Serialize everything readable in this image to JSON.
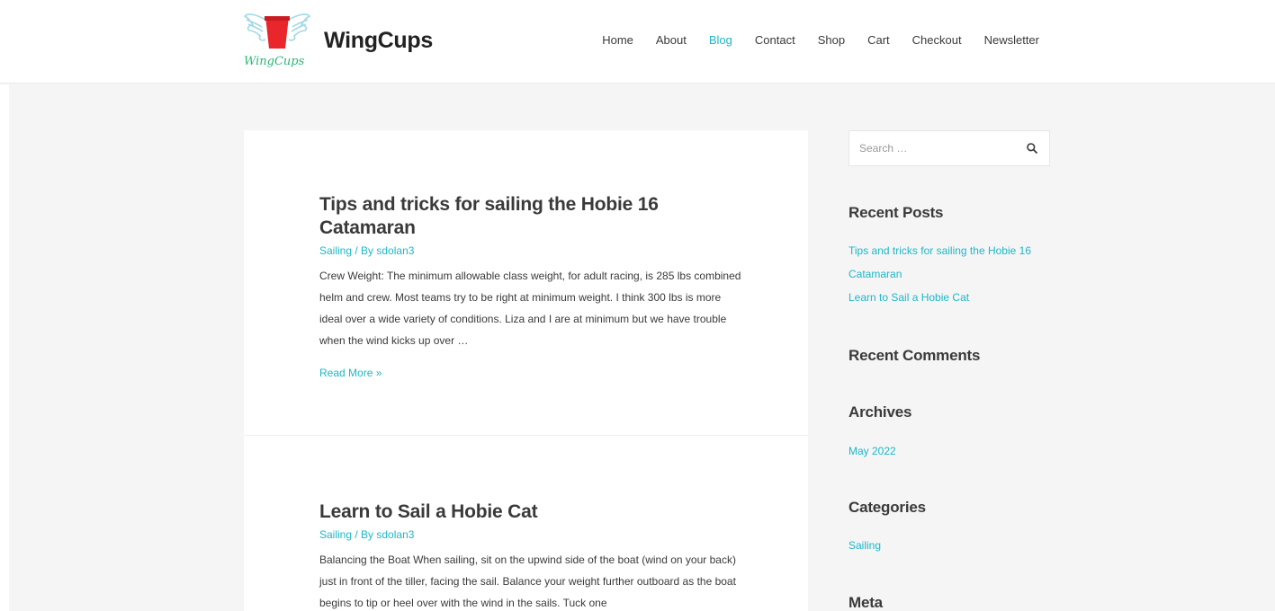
{
  "site": {
    "title": "WingCups",
    "logo_text": "WingCups"
  },
  "nav": {
    "items": [
      {
        "label": "Home"
      },
      {
        "label": "About"
      },
      {
        "label": "Blog"
      },
      {
        "label": "Contact"
      },
      {
        "label": "Shop"
      },
      {
        "label": "Cart"
      },
      {
        "label": "Checkout"
      },
      {
        "label": "Newsletter"
      }
    ],
    "active": "Blog"
  },
  "posts": [
    {
      "title": "Tips and tricks for sailing the Hobie 16 Catamaran",
      "category": "Sailing",
      "separator": " / By ",
      "author": "sdolan3",
      "excerpt": "Crew Weight: The minimum allowable class weight, for adult racing, is 285 lbs combined helm and crew. Most teams try to be right at minimum weight. I think 300 lbs is more ideal over a wide variety of conditions. Liza and I are at minimum but we have trouble when the wind kicks up over …",
      "read_more": "Read More »"
    },
    {
      "title": "Learn to Sail a Hobie Cat",
      "category": "Sailing",
      "separator": " / By ",
      "author": "sdolan3",
      "excerpt": "Balancing the Boat When sailing, sit on the upwind side of the boat (wind on your back) just in front of the tiller, facing the sail. Balance your weight further outboard as the boat begins to tip or heel over with the wind in the sails. Tuck one"
    }
  ],
  "sidebar": {
    "search": {
      "placeholder": "Search …"
    },
    "recent_posts": {
      "title": "Recent Posts",
      "items": [
        "Tips and tricks for sailing the Hobie 16 Catamaran",
        "Learn to Sail a Hobie Cat"
      ]
    },
    "recent_comments": {
      "title": "Recent Comments"
    },
    "archives": {
      "title": "Archives",
      "items": [
        "May 2022"
      ]
    },
    "categories": {
      "title": "Categories",
      "items": [
        "Sailing"
      ]
    },
    "meta": {
      "title": "Meta"
    }
  },
  "colors": {
    "accent": "#1bb8c9",
    "text": "#3a3a3a",
    "background": "#f5f5f5",
    "logo_cup": "#e8262b",
    "logo_wings": "#9fd8e6"
  },
  "icons": [
    "wingcups-logo",
    "search-icon"
  ]
}
